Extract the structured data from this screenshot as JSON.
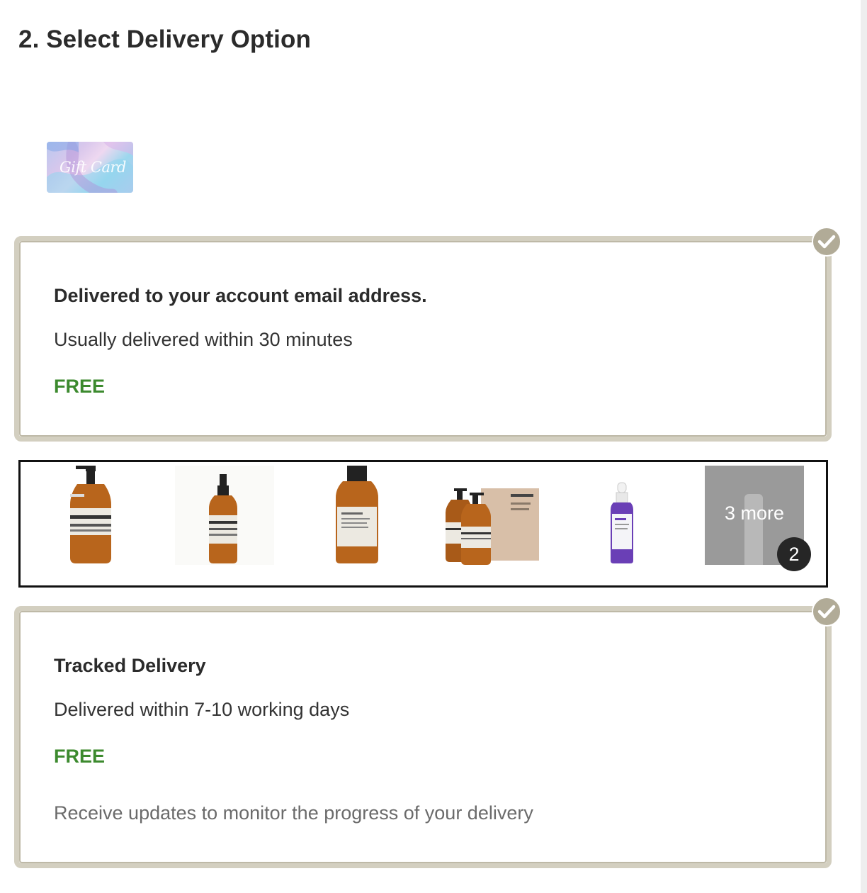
{
  "section": {
    "title": "2. Select Delivery Option"
  },
  "gift_card": {
    "image_text": "Gift Card"
  },
  "delivery_options": [
    {
      "title": "Delivered to your account email address.",
      "description": "Usually delivered within 30 minutes",
      "price": "FREE",
      "selected": true
    },
    {
      "title": "Tracked Delivery",
      "description": "Delivered within 7-10 working days",
      "price": "FREE",
      "note": "Receive updates to monitor the progress of your delivery",
      "selected": true
    }
  ],
  "products_strip": {
    "more_label": "3 more",
    "count_badge": "2",
    "items": [
      "amber-pump-bottle",
      "amber-dropper-bottle",
      "amber-screwcap-bottle",
      "pump-bottles-with-box",
      "purple-serum-dropper"
    ]
  },
  "colors": {
    "price_green": "#3c8a2e",
    "card_border": "#d3cfc0",
    "check_badge": "#b1ab97",
    "strip_border": "#111111"
  },
  "icons": {
    "selected": "checkmark-circle-icon"
  }
}
